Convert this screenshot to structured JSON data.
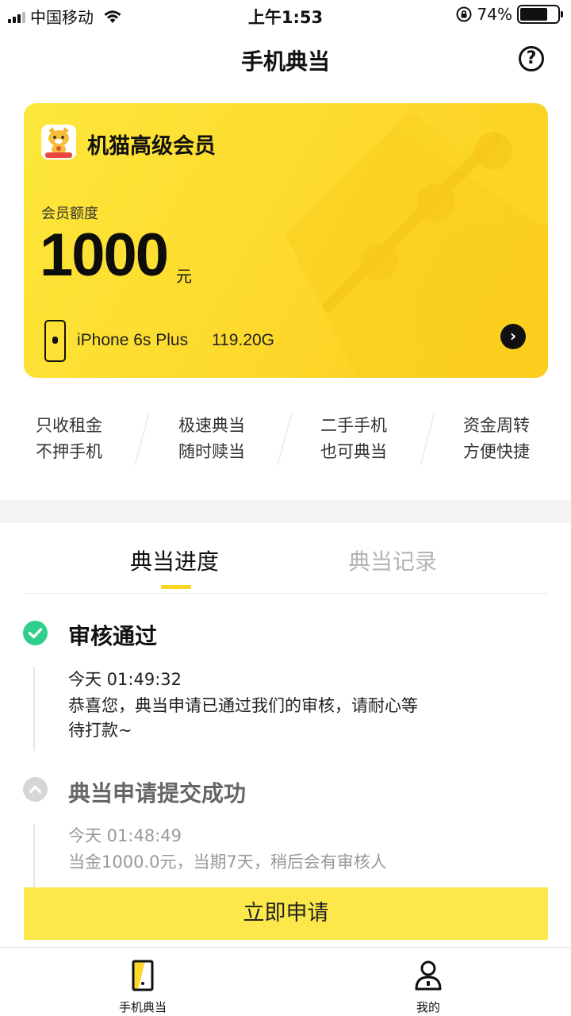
{
  "status_bar": {
    "carrier": "中国移动",
    "time": "上午1:53",
    "battery": "74%",
    "battery_level": 0.74
  },
  "nav": {
    "title": "手机典当",
    "help_glyph": "?"
  },
  "member_card": {
    "title": "机猫高级会员",
    "quota_label": "会员额度",
    "quota_value": "1000",
    "quota_unit": "元",
    "device_name": "iPhone 6s Plus",
    "device_storage": "119.20G",
    "accent_color": "#fdd92c"
  },
  "features": [
    {
      "line1": "只收租金",
      "line2": "不押手机"
    },
    {
      "line1": "极速典当",
      "line2": "随时赎当"
    },
    {
      "line1": "二手手机",
      "line2": "也可典当"
    },
    {
      "line1": "资金周转",
      "line2": "方便快捷"
    }
  ],
  "tabs": {
    "active": "典当进度",
    "inactive": "典当记录"
  },
  "timeline": [
    {
      "title": "审核通过",
      "status": "done",
      "time": "今天 01:49:32",
      "desc": "恭喜您，典当申请已通过我们的审核，请耐心等待打款~",
      "icon": "check-circle-icon",
      "color": "#2ecf8c"
    },
    {
      "title": "典当申请提交成功",
      "status": "past",
      "time": "今天 01:48:49",
      "desc": "当金1000.0元，当期7天，稍后会有审核人",
      "icon": "chevron-up-circle-icon",
      "color": "#d6d6d6"
    }
  ],
  "apply_button": {
    "label": "立即申请",
    "color": "#fce84a"
  },
  "tabbar": [
    {
      "label": "手机典当",
      "icon": "phone-pawn-icon"
    },
    {
      "label": "我的",
      "icon": "user-icon"
    }
  ]
}
